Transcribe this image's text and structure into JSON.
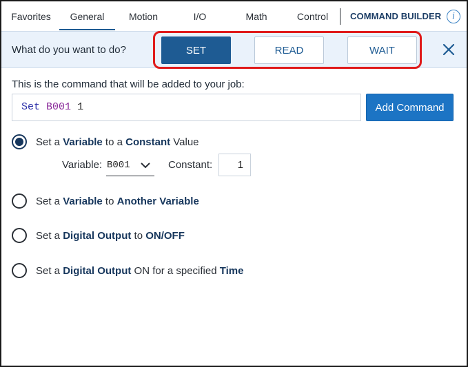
{
  "nav": {
    "tabs": [
      {
        "label": "Favorites",
        "active": false
      },
      {
        "label": "General",
        "active": true
      },
      {
        "label": "Motion",
        "active": false
      },
      {
        "label": "I/O",
        "active": false
      },
      {
        "label": "Math",
        "active": false
      },
      {
        "label": "Control",
        "active": false
      }
    ],
    "builder_title": "COMMAND BUILDER",
    "info_icon": "i"
  },
  "question": {
    "label": "What do you want to do?",
    "options": [
      {
        "label": "SET",
        "selected": true
      },
      {
        "label": "READ",
        "selected": false
      },
      {
        "label": "WAIT",
        "selected": false
      }
    ]
  },
  "command": {
    "caption": "This is the command that will be added to your job:",
    "keyword": "Set",
    "variable": "B001",
    "value": "1",
    "add_label": "Add Command"
  },
  "options": [
    {
      "prefix": "Set a ",
      "b1": "Variable",
      "mid": " to a ",
      "b2": "Constant",
      "suffix": " Value",
      "checked": true
    },
    {
      "prefix": "Set a ",
      "b1": "Variable",
      "mid": " to ",
      "b2": "Another Variable",
      "suffix": "",
      "checked": false
    },
    {
      "prefix": "Set a ",
      "b1": "Digital Output",
      "mid": " to ",
      "b2": "ON/OFF",
      "suffix": "",
      "checked": false
    },
    {
      "prefix": "Set a ",
      "b1": "Digital Output",
      "mid": " ON for a specified ",
      "b2": "Time",
      "suffix": "",
      "checked": false
    }
  ],
  "params": {
    "variable_label": "Variable:",
    "variable_value": "B001",
    "constant_label": "Constant:",
    "constant_value": "1"
  },
  "colors": {
    "primary": "#1e5b93",
    "accent_button": "#1c74c4",
    "highlight": "#e01b1b",
    "question_bar_bg": "#eaf2fb"
  }
}
